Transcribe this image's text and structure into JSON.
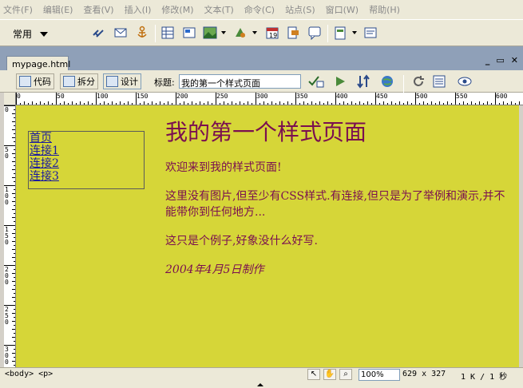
{
  "menu": [
    "文件(F)",
    "编辑(E)",
    "查看(V)",
    "插入(I)",
    "修改(M)",
    "文本(T)",
    "命令(C)",
    "站点(S)",
    "窗口(W)",
    "帮助(H)"
  ],
  "insert_bar": {
    "category": "常用",
    "icons": [
      "hyperlink-icon",
      "email-link-icon",
      "named-anchor-icon",
      "table-icon",
      "layer-icon",
      "image-icon",
      "media-icon",
      "date-icon",
      "comment-icon",
      "template-icon",
      "tag-chooser-icon"
    ]
  },
  "document": {
    "tab_name": "mypage.html",
    "views": {
      "code": "代码",
      "split": "拆分",
      "design": "设计"
    },
    "title_label": "标题:",
    "title_value": "我的第一个样式页面"
  },
  "colors": {
    "page_bg": "#d6d638",
    "heading": "#7a0f50",
    "link": "#1a1aa0"
  },
  "ruler": {
    "h_labels": [
      "0",
      "50",
      "100",
      "150",
      "200",
      "250",
      "300",
      "350",
      "400",
      "450",
      "500",
      "550",
      "600"
    ],
    "v_labels": [
      "0",
      "5\n0",
      "1\n0\n0",
      "1\n5\n0",
      "2\n0\n0",
      "2\n5\n0",
      "3\n0\n0"
    ]
  },
  "page": {
    "nav_links": [
      "首页",
      "连接1",
      "连接2",
      "连接3"
    ],
    "heading": "我的第一个样式页面",
    "paragraphs": [
      "欢迎来到我的样式页面!",
      "这里没有图片,但至少有CSS样式.有连接,但只是为了举例和演示,并不能带你到任何地方...",
      "这只是个例子,好象没什么好写."
    ],
    "signature": "2004年4月5日制作"
  },
  "status": {
    "tag_selector": "<body> <p>",
    "zoom": "100%",
    "dimensions": "629 x 327",
    "size_time": "1 K / 1 秒"
  }
}
